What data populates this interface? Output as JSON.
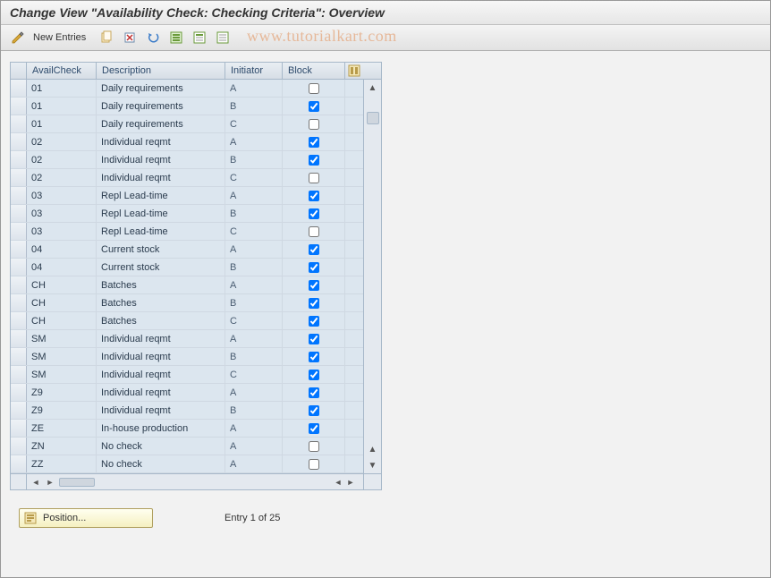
{
  "title": "Change View \"Availability Check: Checking Criteria\": Overview",
  "watermark": "www.tutorialkart.com",
  "toolbar": {
    "new_entries_label": "New Entries"
  },
  "grid": {
    "headers": {
      "avail": "AvailCheck",
      "desc": "Description",
      "init": "Initiator",
      "block": "Block"
    },
    "rows": [
      {
        "avail": "01",
        "desc": "Daily requirements",
        "init": "A",
        "block": false
      },
      {
        "avail": "01",
        "desc": "Daily requirements",
        "init": "B",
        "block": true
      },
      {
        "avail": "01",
        "desc": "Daily requirements",
        "init": "C",
        "block": false
      },
      {
        "avail": "02",
        "desc": "Individual reqmt",
        "init": "A",
        "block": true
      },
      {
        "avail": "02",
        "desc": "Individual reqmt",
        "init": "B",
        "block": true
      },
      {
        "avail": "02",
        "desc": "Individual reqmt",
        "init": "C",
        "block": false
      },
      {
        "avail": "03",
        "desc": "Repl Lead-time",
        "init": "A",
        "block": true
      },
      {
        "avail": "03",
        "desc": "Repl Lead-time",
        "init": "B",
        "block": true
      },
      {
        "avail": "03",
        "desc": "Repl Lead-time",
        "init": "C",
        "block": false
      },
      {
        "avail": "04",
        "desc": "Current stock",
        "init": "A",
        "block": true
      },
      {
        "avail": "04",
        "desc": "Current stock",
        "init": "B",
        "block": true
      },
      {
        "avail": "CH",
        "desc": "Batches",
        "init": "A",
        "block": true
      },
      {
        "avail": "CH",
        "desc": "Batches",
        "init": "B",
        "block": true
      },
      {
        "avail": "CH",
        "desc": "Batches",
        "init": "C",
        "block": true
      },
      {
        "avail": "SM",
        "desc": "Individual reqmt",
        "init": "A",
        "block": true
      },
      {
        "avail": "SM",
        "desc": "Individual reqmt",
        "init": "B",
        "block": true
      },
      {
        "avail": "SM",
        "desc": "Individual reqmt",
        "init": "C",
        "block": true
      },
      {
        "avail": "Z9",
        "desc": "Individual reqmt",
        "init": "A",
        "block": true
      },
      {
        "avail": "Z9",
        "desc": "Individual reqmt",
        "init": "B",
        "block": true
      },
      {
        "avail": "ZE",
        "desc": "In-house production",
        "init": "A",
        "block": true
      },
      {
        "avail": "ZN",
        "desc": "No check",
        "init": "A",
        "block": false
      },
      {
        "avail": "ZZ",
        "desc": "No check",
        "init": "A",
        "block": false
      }
    ]
  },
  "footer": {
    "position_label": "Position...",
    "entry_info": "Entry 1 of 25"
  }
}
